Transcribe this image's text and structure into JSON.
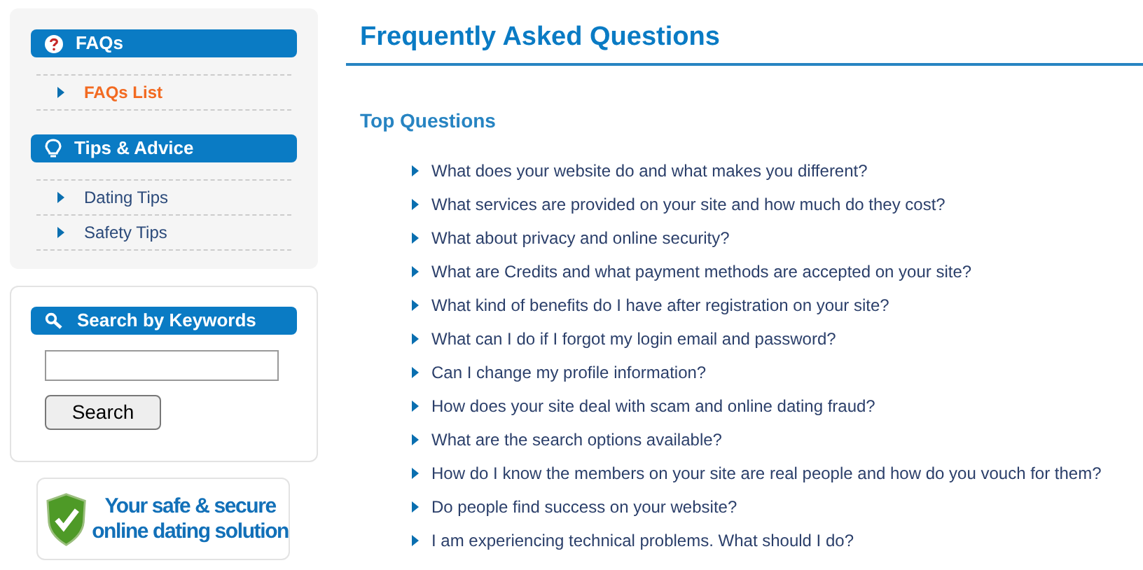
{
  "sidebar": {
    "sections": [
      {
        "title": "FAQs",
        "kind": "question",
        "items": [
          {
            "label": "FAQs List",
            "selected": true
          }
        ]
      },
      {
        "title": "Tips & Advice",
        "kind": "bulb",
        "items": [
          {
            "label": "Dating Tips",
            "selected": false
          },
          {
            "label": "Safety Tips",
            "selected": false
          }
        ]
      }
    ]
  },
  "search_panel": {
    "title": "Search by Keywords",
    "button": "Search"
  },
  "badge": {
    "lines": [
      "Your safe & secure",
      "online dating solution"
    ]
  },
  "main": {
    "title": "Frequently Asked Questions",
    "subtitle": "Top Questions",
    "questions": [
      "What does your website do and what makes you different?",
      "What services are provided on your site and how much do they cost?",
      "What about privacy and online security?",
      "What are Credits and what payment methods are accepted on your site?",
      "What kind of benefits do I have after registration on your site?",
      "What can I do if I forgot my login email and password?",
      "Can I change my profile information?",
      "How does your site deal with scam and online dating fraud?",
      "What are the search options available?",
      "How do I know the members on your site are real people and how do you vouch for them?",
      "Do people find success on your website?",
      "I am experiencing technical problems. What should I do?"
    ]
  }
}
